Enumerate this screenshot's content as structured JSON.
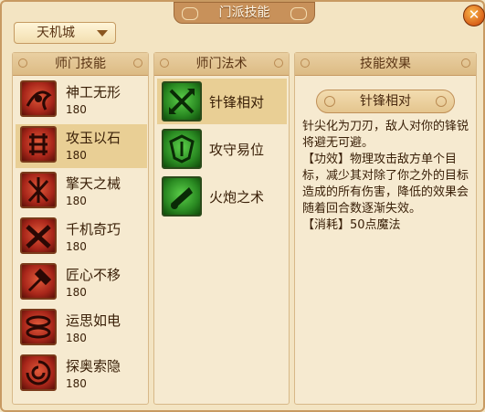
{
  "window": {
    "title": "门派技能"
  },
  "city_select": {
    "value": "天机城"
  },
  "panels": {
    "sect_skills_header": "师门技能",
    "sect_spells_header": "师门法术",
    "effect_header": "技能效果"
  },
  "sect_skills": [
    {
      "name": "神工无形",
      "level": "180",
      "icon": "sigil-icon"
    },
    {
      "name": "攻玉以石",
      "level": "180",
      "icon": "lattice-icon"
    },
    {
      "name": "擎天之械",
      "level": "180",
      "icon": "pillar-icon"
    },
    {
      "name": "千机奇巧",
      "level": "180",
      "icon": "cross-tools-icon"
    },
    {
      "name": "匠心不移",
      "level": "180",
      "icon": "hammer-icon"
    },
    {
      "name": "运思如电",
      "level": "180",
      "icon": "swirl-icon"
    },
    {
      "name": "探奥索隐",
      "level": "180",
      "icon": "vortex-icon"
    }
  ],
  "selected_skill_index": 1,
  "sect_spells": [
    {
      "name": "针锋相对",
      "icon": "crossed-blades-icon"
    },
    {
      "name": "攻守易位",
      "icon": "shield-swap-icon"
    },
    {
      "name": "火炮之术",
      "icon": "cannon-icon"
    }
  ],
  "selected_spell_index": 0,
  "effect": {
    "title": "针锋相对",
    "description": "针尖化为刀刃，敌人对你的锋锐将避无可避。",
    "effect_line": "【功效】物理攻击敌方单个目标，减少其对除了你之外的目标造成的所有伤害，降低的效果会随着回合数逐渐失效。",
    "cost_line": "【消耗】50点魔法"
  },
  "colors": {
    "skill_icon_bg": "#b8301e",
    "spell_icon_bg": "#2f8f26",
    "selected_row": "#e9cf95",
    "close_button": "#e06a1e"
  }
}
